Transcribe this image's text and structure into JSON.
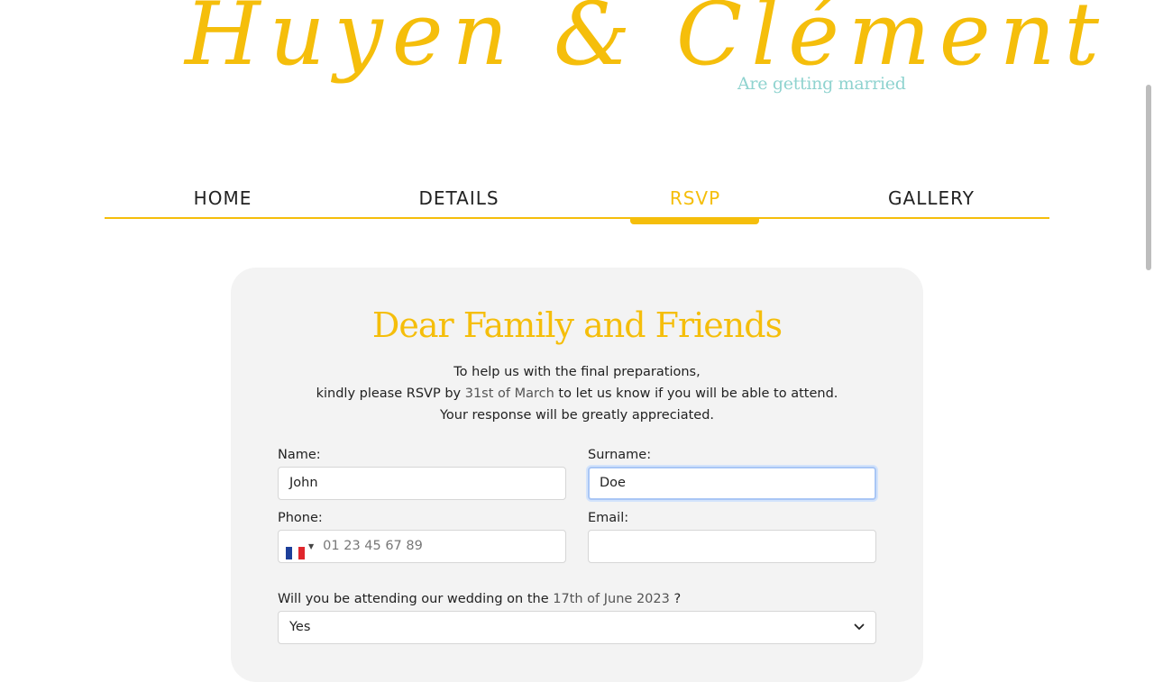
{
  "header": {
    "title": "Huyen & Clément",
    "subtitle": "Are getting married"
  },
  "nav": {
    "items": [
      {
        "label": "HOME",
        "active": false
      },
      {
        "label": "DETAILS",
        "active": false
      },
      {
        "label": "RSVP",
        "active": true
      },
      {
        "label": "GALLERY",
        "active": false
      }
    ]
  },
  "rsvp": {
    "title": "Dear Family and Friends",
    "intro": {
      "line1": "To help us with the final preparations,",
      "line2_before": "kindly please RSVP by ",
      "line2_date": "31st of March",
      "line2_after": " to let us know if you will be able to attend.",
      "line3": "Your response will be greatly appreciated."
    },
    "fields": {
      "name_label": "Name:",
      "name_value": "John",
      "surname_label": "Surname:",
      "surname_value": "Doe",
      "phone_label": "Phone:",
      "phone_placeholder": "01 23 45 67 89",
      "phone_country": "France",
      "email_label": "Email:",
      "email_value": ""
    },
    "question": {
      "before": "Will you be attending our wedding on the ",
      "date": "17th of June 2023",
      "after": " ?"
    },
    "attending_selected": "Yes"
  },
  "colors": {
    "accent": "#f5be0b",
    "subtitle": "#8fd3cf",
    "card_bg": "#f3f3f3",
    "focus_ring": "#a9c6f5"
  }
}
